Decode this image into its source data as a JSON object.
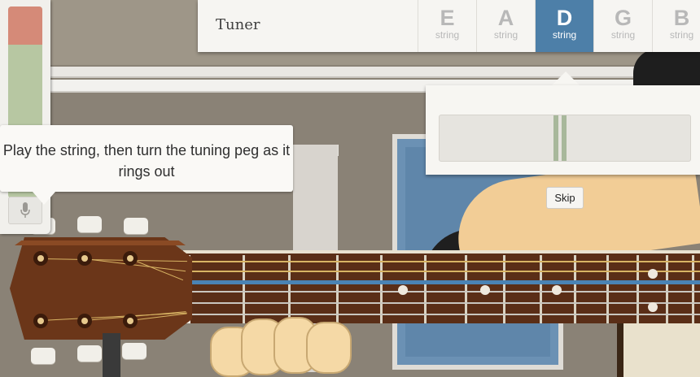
{
  "tuner": {
    "title": "Tuner",
    "tabs": [
      {
        "note": "E",
        "label": "string",
        "active": false
      },
      {
        "note": "A",
        "label": "string",
        "active": false
      },
      {
        "note": "D",
        "label": "string",
        "active": true
      },
      {
        "note": "G",
        "label": "string",
        "active": false
      },
      {
        "note": "B",
        "label": "string",
        "active": false
      }
    ]
  },
  "instructions": {
    "text": "Play the string, then turn the tuning peg as it rings out"
  },
  "skip": {
    "label": "Skip"
  },
  "meter": {
    "level_fraction": 0.48
  },
  "input_level": {
    "fraction": 0.2
  },
  "colors": {
    "active_tab": "#4d7fa8",
    "tuning_needle": "#a8b89b",
    "level_high": "#d58a78",
    "level_ok": "#b7c7a2",
    "active_string": "#4a83b4"
  },
  "icons": {
    "mic": "microphone-icon"
  }
}
